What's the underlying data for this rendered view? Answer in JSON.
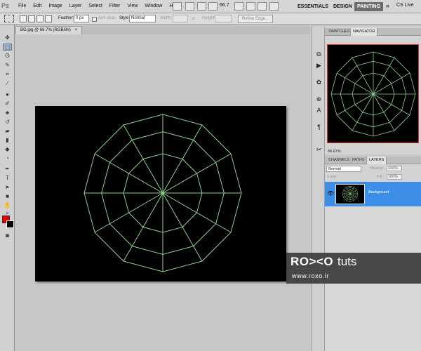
{
  "appbar": {
    "logo": "Ps",
    "menu": [
      "File",
      "Edit",
      "Image",
      "Layer",
      "Select",
      "Filter",
      "View",
      "Window",
      "Help"
    ],
    "zoom": "66.7",
    "workspaces": [
      "ESSENTIALS",
      "DESIGN",
      "PAINTING"
    ],
    "active_workspace": "PAINTING",
    "overflow": "»",
    "cs_live": "CS Live"
  },
  "options": {
    "feather_label": "Feather:",
    "feather_value": "0 px",
    "antialias_label": "Anti-alias",
    "style_label": "Style:",
    "style_value": "Normal",
    "width_label": "Width:",
    "height_label": "Height:",
    "refine_edge": "Refine Edge..."
  },
  "document": {
    "tab_title": "BG.jpg @ 66.7% (RGB/8#)",
    "close_glyph": "×"
  },
  "colors": {
    "foreground": "#e00000",
    "background": "#000000",
    "wireframe": "#8fcf8f",
    "layer_selected": "#3d8ee6"
  },
  "icons": {
    "tools": [
      "move-icon",
      "marquee-icon",
      "lasso-icon",
      "quick-select-icon",
      "crop-icon",
      "eyedropper-icon",
      "healing-icon",
      "brush-icon",
      "clone-stamp-icon",
      "history-brush-icon",
      "eraser-icon",
      "gradient-icon",
      "blur-icon",
      "dodge-icon",
      "pen-icon",
      "type-icon",
      "path-select-icon",
      "shape-icon",
      "hand-icon",
      "zoom-icon"
    ],
    "strip": [
      "history-icon",
      "actions-icon",
      "brushes-icon",
      "clone-source-icon",
      "character-icon",
      "paragraph-icon",
      "tools-preset-icon"
    ]
  },
  "navigator": {
    "tabs": [
      "SWATCHES",
      "NAVIGATOR"
    ],
    "active_tab": "NAVIGATOR",
    "zoom": "66.67%"
  },
  "layers_panel": {
    "tabs": [
      "CHANNELS",
      "PATHS",
      "LAYERS"
    ],
    "active_tab": "LAYERS",
    "blend_mode": "Normal",
    "opacity_label": "Opacity:",
    "opacity_value": "100%",
    "lock_label": "Lock:",
    "fill_label": "Fill:",
    "fill_value": "100%",
    "layers": [
      {
        "name": "Background",
        "visible": true,
        "selected": true
      }
    ]
  },
  "watermark": {
    "brand": "RO><O",
    "tuts": "tuts",
    "url": "www.roxo.ir"
  }
}
